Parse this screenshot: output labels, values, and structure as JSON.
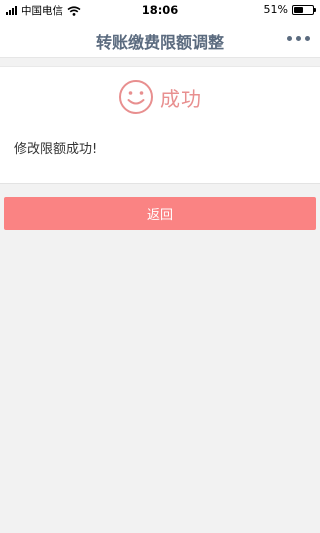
{
  "status_bar": {
    "carrier": "中国电信",
    "time": "18:06",
    "battery_text": "51%",
    "battery_level": 0.51
  },
  "nav": {
    "title": "转账缴费限额调整",
    "more_icon": "more-icon"
  },
  "result": {
    "icon": "smile-icon",
    "status_text": "成功",
    "message": "修改限额成功!"
  },
  "actions": {
    "return_label": "返回"
  },
  "colors": {
    "accent": "#fa8383",
    "success_text": "#e88f8f",
    "nav_title": "#5b6b7f",
    "background": "#f2f2f2"
  }
}
